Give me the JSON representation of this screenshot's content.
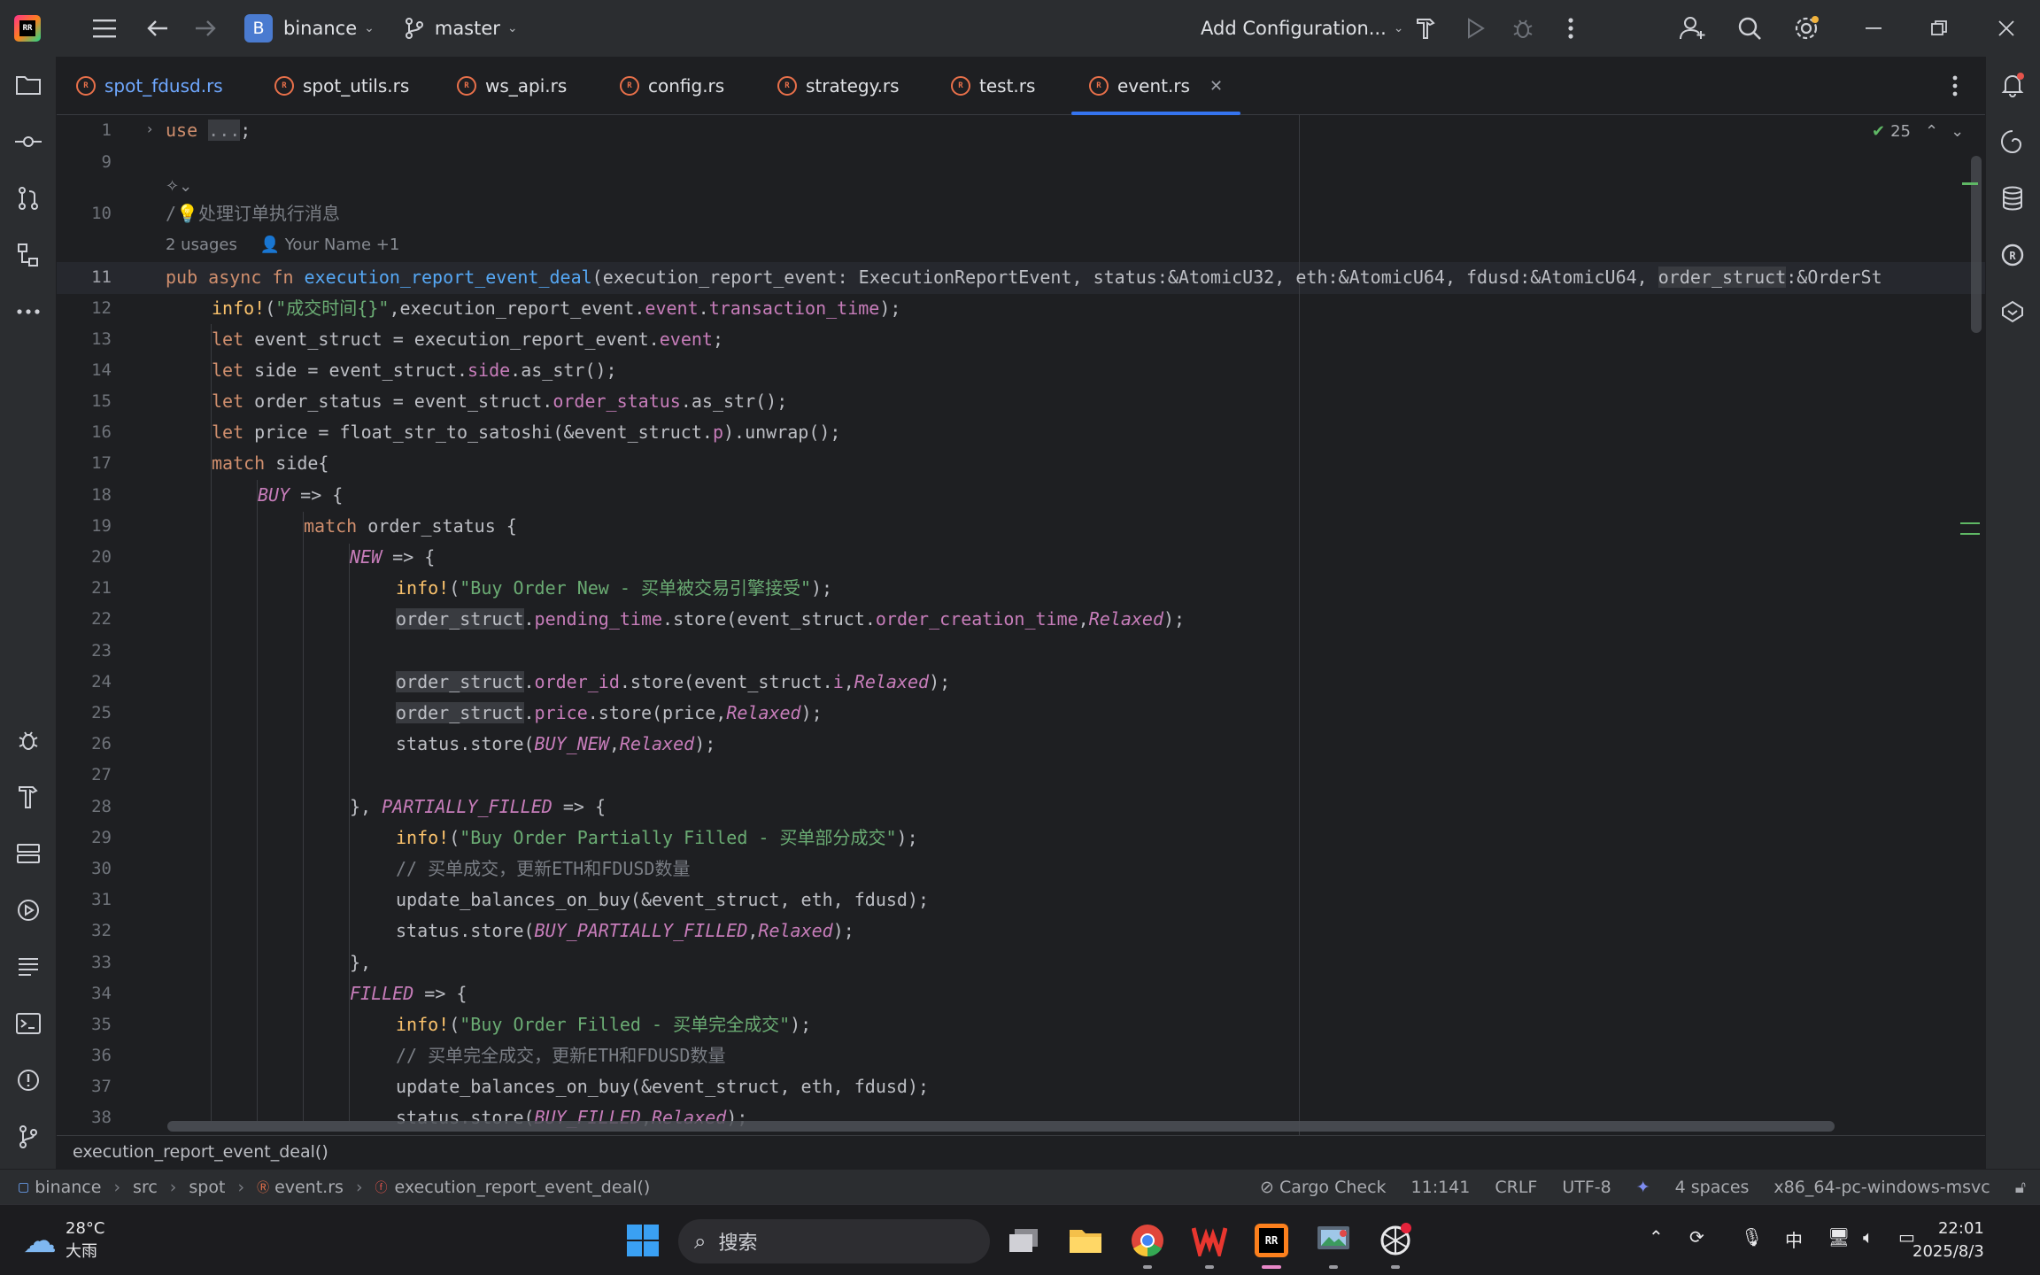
{
  "titlebar": {
    "project_badge": "B",
    "project_name": "binance",
    "branch": "master",
    "run_config": "Add Configuration..."
  },
  "tabs": [
    {
      "name": "spot_fdusd.rs"
    },
    {
      "name": "spot_utils.rs"
    },
    {
      "name": "ws_api.rs"
    },
    {
      "name": "config.rs"
    },
    {
      "name": "strategy.rs"
    },
    {
      "name": "test.rs"
    },
    {
      "name": "event.rs"
    }
  ],
  "editor": {
    "inspections_count": "25",
    "line_numbers": [
      "1",
      "9",
      "10",
      "11",
      "12",
      "13",
      "14",
      "15",
      "16",
      "17",
      "18",
      "19",
      "20",
      "21",
      "22",
      "23",
      "24",
      "25",
      "26",
      "27",
      "28",
      "29",
      "30",
      "31",
      "32",
      "33",
      "34",
      "35",
      "36",
      "37",
      "38"
    ],
    "usages_hint": "2 usages",
    "author_hint": "Your Name +1",
    "doc_comment": "处理订单执行消息",
    "lines": {
      "l1": "use ...;",
      "l11": "pub async fn execution_report_event_deal(execution_report_event: ExecutionReportEvent, status:&AtomicU32, eth:&AtomicU64, fdusd:&AtomicU64, order_struct:&OrderSt",
      "l12": "info!(\"成交时间{}\",execution_report_event.event.transaction_time);",
      "l13": "let event_struct = execution_report_event.event;",
      "l14": "let side = event_struct.side.as_str();",
      "l15": "let order_status = event_struct.order_status.as_str();",
      "l16": "let price = float_str_to_satoshi(&event_struct.p).unwrap();",
      "l17": "match side{",
      "l18": "BUY => {",
      "l19": "match order_status {",
      "l20": "NEW => {",
      "l21": "info!(\"Buy Order New - 买单被交易引擎接受\");",
      "l22": "order_struct.pending_time.store(event_struct.order_creation_time,Relaxed);",
      "l24": "order_struct.order_id.store(event_struct.i,Relaxed);",
      "l25": "order_struct.price.store(price,Relaxed);",
      "l26": "status.store(BUY_NEW,Relaxed);",
      "l28": "}, PARTIALLY_FILLED => {",
      "l29": "info!(\"Buy Order Partially Filled - 买单部分成交\");",
      "l30": "// 买单成交，更新ETH和FDUSD数量",
      "l31": "update_balances_on_buy(&event_struct, eth, fdusd);",
      "l32": "status.store(BUY_PARTIALLY_FILLED,Relaxed);",
      "l33": "},",
      "l34": "FILLED => {",
      "l35": "info!(\"Buy Order Filled - 买单完全成交\");",
      "l36": "// 买单完全成交，更新ETH和FDUSD数量",
      "l37": "update_balances_on_buy(&event_struct, eth, fdusd);",
      "l38": "status.store(BUY_FILLED,Relaxed);"
    }
  },
  "editor_breadcrumb": "execution_report_event_deal()",
  "statusbar": {
    "crumbs": [
      "binance",
      "src",
      "spot",
      "event.rs",
      "execution_report_event_deal()"
    ],
    "cargo_check": "Cargo Check",
    "position": "11:141",
    "line_sep": "CRLF",
    "encoding": "UTF-8",
    "indent": "4 spaces",
    "toolchain": "x86_64-pc-windows-msvc"
  },
  "taskbar": {
    "temperature": "28°C",
    "weather": "大雨",
    "search_placeholder": "搜索",
    "ime": "中",
    "time": "22:01",
    "date": "2025/8/3"
  },
  "colors": {
    "accent": "#3574f0",
    "keyword": "#cf8e6d",
    "function": "#56a8f5",
    "macro": "#fac26c",
    "string": "#6aab73",
    "field": "#c77dba"
  }
}
